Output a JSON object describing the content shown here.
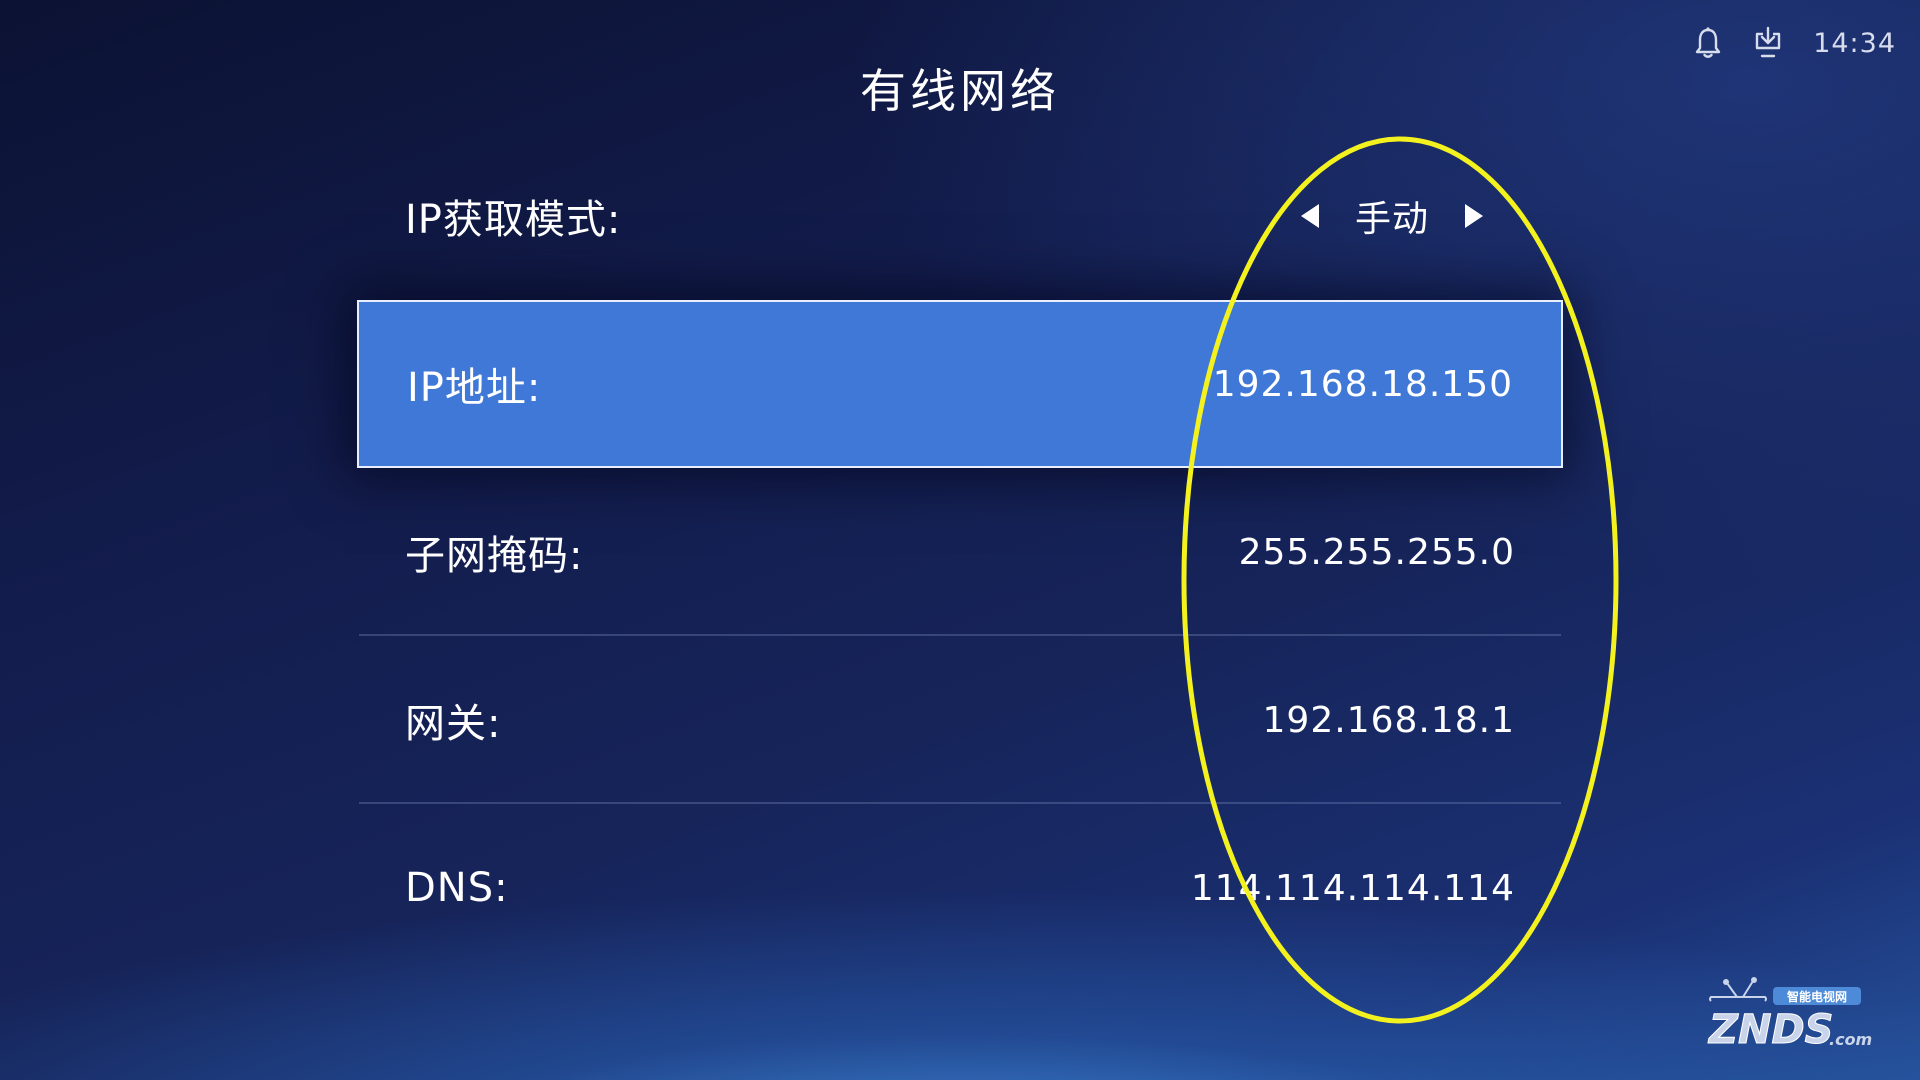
{
  "status_bar": {
    "time": "14:34",
    "icons": [
      "bell-icon",
      "download-icon"
    ]
  },
  "title": "有线网络",
  "settings": {
    "ip_mode": {
      "label": "IP获取模式:",
      "value": "手动"
    },
    "ip_address": {
      "label": "IP地址:",
      "value": "192.168.18.150"
    },
    "subnet_mask": {
      "label": "子网掩码:",
      "value": "255.255.255.0"
    },
    "gateway": {
      "label": "网关:",
      "value": "192.168.18.1"
    },
    "dns": {
      "label": "DNS:",
      "value": "114.114.114.114"
    }
  },
  "colors": {
    "selected_row": "#3f78d6",
    "annotation": "#f4f21e"
  },
  "watermark": {
    "brand": "ZNDS",
    "suffix": ".com",
    "tagline": "智能电视网"
  }
}
